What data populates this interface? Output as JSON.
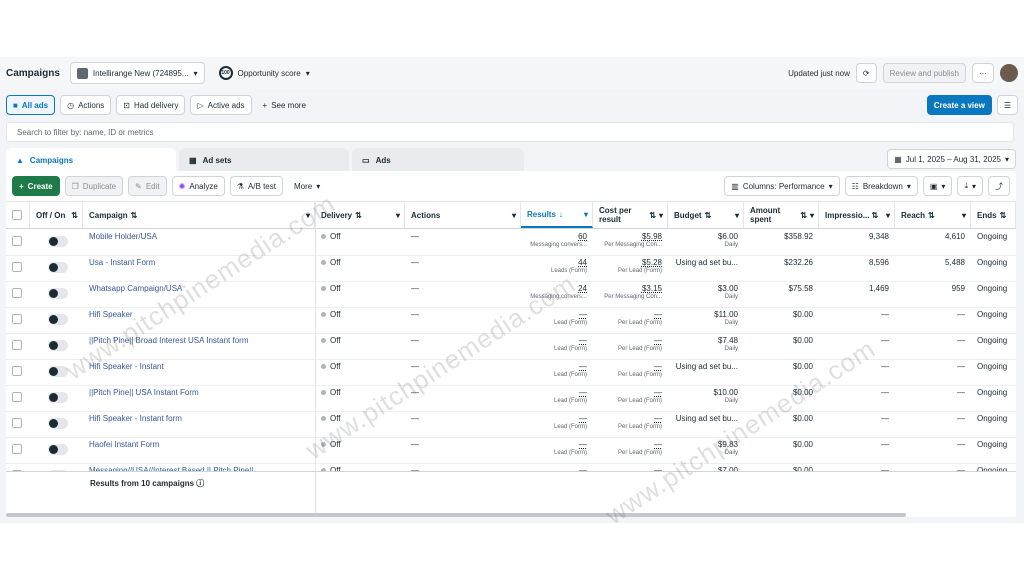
{
  "header": {
    "title": "Campaigns",
    "account": "Intellirange New (724895...",
    "opportunity_value": "100",
    "opportunity_label": "Opportunity score",
    "updated": "Updated just now",
    "review_publish": "Review and publish",
    "more": "···"
  },
  "filters": {
    "all_ads": "All ads",
    "actions": "Actions",
    "had_delivery": "Had delivery",
    "active_ads": "Active ads",
    "see_more": "See more",
    "create_view": "Create a view"
  },
  "search": {
    "placeholder": "Search to filter by: name, ID or metrics"
  },
  "tabs": {
    "campaigns": "Campaigns",
    "ad_sets": "Ad sets",
    "ads": "Ads"
  },
  "date_range": "Jul 1, 2025 – Aug 31, 2025",
  "toolbar": {
    "create": "Create",
    "duplicate": "Duplicate",
    "edit": "Edit",
    "analyze": "Analyze",
    "ab_test": "A/B test",
    "more": "More",
    "columns": "Columns: Performance",
    "breakdown": "Breakdown"
  },
  "columns": {
    "off_on": "Off / On",
    "campaign": "Campaign",
    "delivery": "Delivery",
    "actions": "Actions",
    "results": "Results",
    "cost_per_result": "Cost per result",
    "budget": "Budget",
    "amount_spent": "Amount spent",
    "impressions": "Impressio...",
    "reach": "Reach",
    "ends": "Ends"
  },
  "rows": [
    {
      "name": "Mobile Holder/USA",
      "delivery": "Off",
      "actions": "—",
      "results": "60",
      "results_sub": "Messaging convers...",
      "cpr": "$5.98",
      "cpr_sub": "Per Messaging Con...",
      "budget": "$6.00",
      "budget_sub": "Daily",
      "spent": "$358.92",
      "impr": "9,348",
      "reach": "4,610",
      "ends": "Ongoing"
    },
    {
      "name": "Usa - Instant Form",
      "delivery": "Off",
      "actions": "—",
      "results": "44",
      "results_sub": "Leads (Form)",
      "cpr": "$5.28",
      "cpr_sub": "Per Lead (Form)",
      "budget": "Using ad set bu...",
      "budget_sub": "",
      "spent": "$232.26",
      "impr": "8,596",
      "reach": "5,488",
      "ends": "Ongoing"
    },
    {
      "name": "Whatsapp Campaign/USA",
      "delivery": "Off",
      "actions": "—",
      "results": "24",
      "results_sub": "Messaging convers...",
      "cpr": "$3.15",
      "cpr_sub": "Per Messaging Con...",
      "budget": "$3.00",
      "budget_sub": "Daily",
      "spent": "$75.58",
      "impr": "1,469",
      "reach": "959",
      "ends": "Ongoing"
    },
    {
      "name": "Hifi Speaker",
      "delivery": "Off",
      "actions": "—",
      "results": "—",
      "results_sub": "Lead (Form)",
      "cpr": "—",
      "cpr_sub": "Per Lead (Form)",
      "budget": "$11.00",
      "budget_sub": "Daily",
      "spent": "$0.00",
      "impr": "—",
      "reach": "—",
      "ends": "Ongoing"
    },
    {
      "name": "||Pitch Pine|| Broad Interest USA Instant form",
      "delivery": "Off",
      "actions": "—",
      "results": "—",
      "results_sub": "Lead (Form)",
      "cpr": "—",
      "cpr_sub": "Per Lead (Form)",
      "budget": "$7.48",
      "budget_sub": "Daily",
      "spent": "$0.00",
      "impr": "—",
      "reach": "—",
      "ends": "Ongoing"
    },
    {
      "name": "Hifi Speaker - Instant",
      "delivery": "Off",
      "actions": "—",
      "results": "—",
      "results_sub": "Lead (Form)",
      "cpr": "—",
      "cpr_sub": "Per Lead (Form)",
      "budget": "Using ad set bu...",
      "budget_sub": "",
      "spent": "$0.00",
      "impr": "—",
      "reach": "—",
      "ends": "Ongoing"
    },
    {
      "name": "||Pitch Pine|| USA Instant Form",
      "delivery": "Off",
      "actions": "—",
      "results": "—",
      "results_sub": "Lead (Form)",
      "cpr": "—",
      "cpr_sub": "Per Lead (Form)",
      "budget": "$10.00",
      "budget_sub": "Daily",
      "spent": "$0.00",
      "impr": "—",
      "reach": "—",
      "ends": "Ongoing"
    },
    {
      "name": "Hifi Speaker - Instant form",
      "delivery": "Off",
      "actions": "—",
      "results": "—",
      "results_sub": "Lead (Form)",
      "cpr": "—",
      "cpr_sub": "Per Lead (Form)",
      "budget": "Using ad set bu...",
      "budget_sub": "",
      "spent": "$0.00",
      "impr": "—",
      "reach": "—",
      "ends": "Ongoing"
    },
    {
      "name": "Haofei Instant Form",
      "delivery": "Off",
      "actions": "—",
      "results": "—",
      "results_sub": "Lead (Form)",
      "cpr": "—",
      "cpr_sub": "Per Lead (Form)",
      "budget": "$9.83",
      "budget_sub": "Daily",
      "spent": "$0.00",
      "impr": "—",
      "reach": "—",
      "ends": "Ongoing"
    },
    {
      "name": "Messaging//USA//Interest Based || Pitch Pine||",
      "delivery": "Off",
      "actions": "—",
      "results": "—",
      "results_sub": "",
      "cpr": "—",
      "cpr_sub": "",
      "budget": "$7.00",
      "budget_sub": "",
      "spent": "$0.00",
      "impr": "—",
      "reach": "—",
      "ends": "Ongoing"
    }
  ],
  "footer": {
    "summary": "Results from 10 campaigns"
  },
  "watermark": "www.pitchpinemedia.com",
  "colors": {
    "accent": "#0a78be",
    "create": "#1e7b49",
    "link": "#385898"
  }
}
